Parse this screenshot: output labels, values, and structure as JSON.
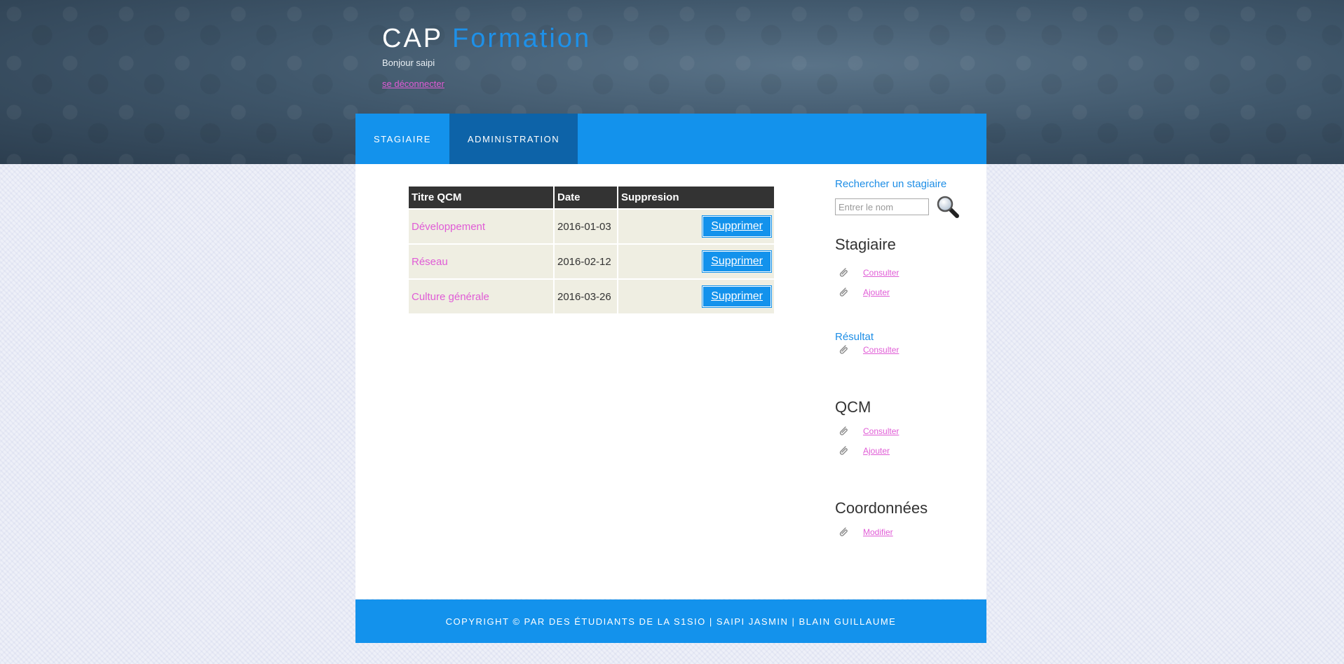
{
  "header": {
    "brand_main": "CAP",
    "brand_accent": "Formation",
    "greeting": "Bonjour saipi",
    "logout_label": "se déconnecter"
  },
  "nav": {
    "items": [
      {
        "label": "STAGIAIRE"
      },
      {
        "label": "ADMINISTRATION",
        "active": true
      }
    ]
  },
  "table": {
    "headers": [
      "Titre QCM",
      "Date",
      "Suppresion"
    ],
    "rows": [
      {
        "title": "Développement",
        "date": "2016-01-03",
        "action": "Supprimer"
      },
      {
        "title": "Réseau",
        "date": "2016-02-12",
        "action": "Supprimer"
      },
      {
        "title": "Culture générale",
        "date": "2016-03-26",
        "action": "Supprimer"
      }
    ]
  },
  "sidebar": {
    "search_title": "Rechercher un stagiaire",
    "search_placeholder": "Entrer le nom",
    "stagiaire": {
      "title": "Stagiaire",
      "links": [
        "Consulter",
        "Ajouter"
      ]
    },
    "resultat": {
      "title": "Résultat",
      "links": [
        "Consulter"
      ]
    },
    "qcm": {
      "title": "QCM",
      "links": [
        "Consulter",
        "Ajouter"
      ]
    },
    "coordonnees": {
      "title": "Coordonnées",
      "links": [
        "Modifier"
      ]
    }
  },
  "footer": {
    "text": "COPYRIGHT © PAR DES ÉTUDIANTS DE LA S1SIO | SAIPI JASMIN | BLAIN GUILLAUME"
  },
  "colors": {
    "accent": "#1392ec",
    "nav_active": "#0d63a8",
    "link": "#e05cd6",
    "table_header": "#333333",
    "table_cell": "#efeee2"
  }
}
